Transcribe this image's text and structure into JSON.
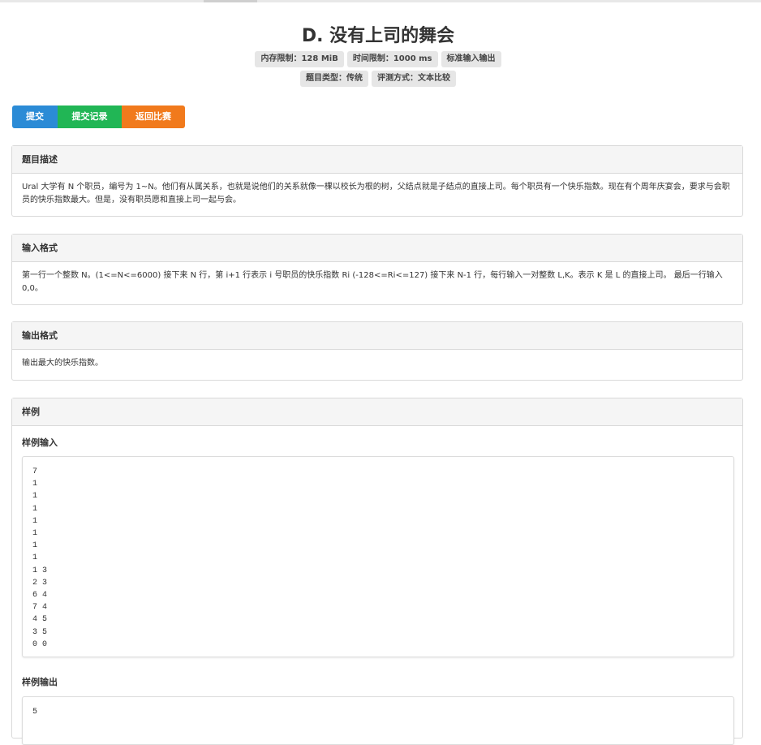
{
  "problem": {
    "title": "D. 没有上司的舞会",
    "labels_row1": [
      "内存限制：128 MiB",
      "时间限制：1000 ms",
      "标准输入输出"
    ],
    "labels_row2": [
      "题目类型：传统",
      "评测方式：文本比较"
    ]
  },
  "actions": {
    "submit_label": "提交",
    "records_label": "提交记录",
    "back_label": "返回比赛"
  },
  "description": {
    "heading": "题目描述",
    "text": "Ural 大学有 N 个职员，编号为 1~N。他们有从属关系，也就是说他们的关系就像一棵以校长为根的树，父结点就是子结点的直接上司。每个职员有一个快乐指数。现在有个周年庆宴会，要求与会职员的快乐指数最大。但是，没有职员愿和直接上司一起与会。"
  },
  "input_format": {
    "heading": "输入格式",
    "text": "第一行一个整数 N。(1<=N<=6000) 接下来 N 行，第 i+1 行表示 i 号职员的快乐指数 Ri (-128<=Ri<=127) 接下来 N-1 行，每行输入一对整数 L,K。表示 K 是 L 的直接上司。 最后一行输入 0,0。"
  },
  "output_format": {
    "heading": "输出格式",
    "text": "输出最大的快乐指数。"
  },
  "sample": {
    "heading": "样例",
    "input_title": "样例输入",
    "input": "7\n1\n1\n1\n1\n1\n1\n1\n1 3\n2 3\n6 4\n7 4\n4 5\n3 5\n0 0",
    "output_title": "样例输出",
    "output": "5"
  }
}
